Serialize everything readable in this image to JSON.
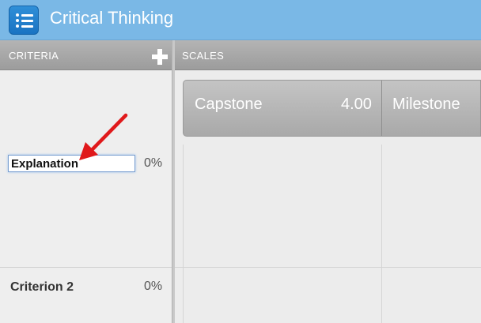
{
  "app": {
    "title": "Critical Thinking",
    "menu_icon": "list-menu-icon",
    "title_bar_color": "#7ab8e6"
  },
  "criteria": {
    "header": "CRITERIA",
    "add_icon": "plus-icon",
    "items": [
      {
        "name": "Explanation",
        "percent": "0%",
        "editing": true
      },
      {
        "name": "Criterion 2",
        "percent": "0%",
        "editing": false
      }
    ]
  },
  "scales": {
    "header": "SCALES",
    "items": [
      {
        "name": "Capstone",
        "score": "4.00"
      },
      {
        "name": "Milestone",
        "score": ""
      }
    ]
  },
  "annotation": {
    "arrow_color": "#e0191b"
  }
}
